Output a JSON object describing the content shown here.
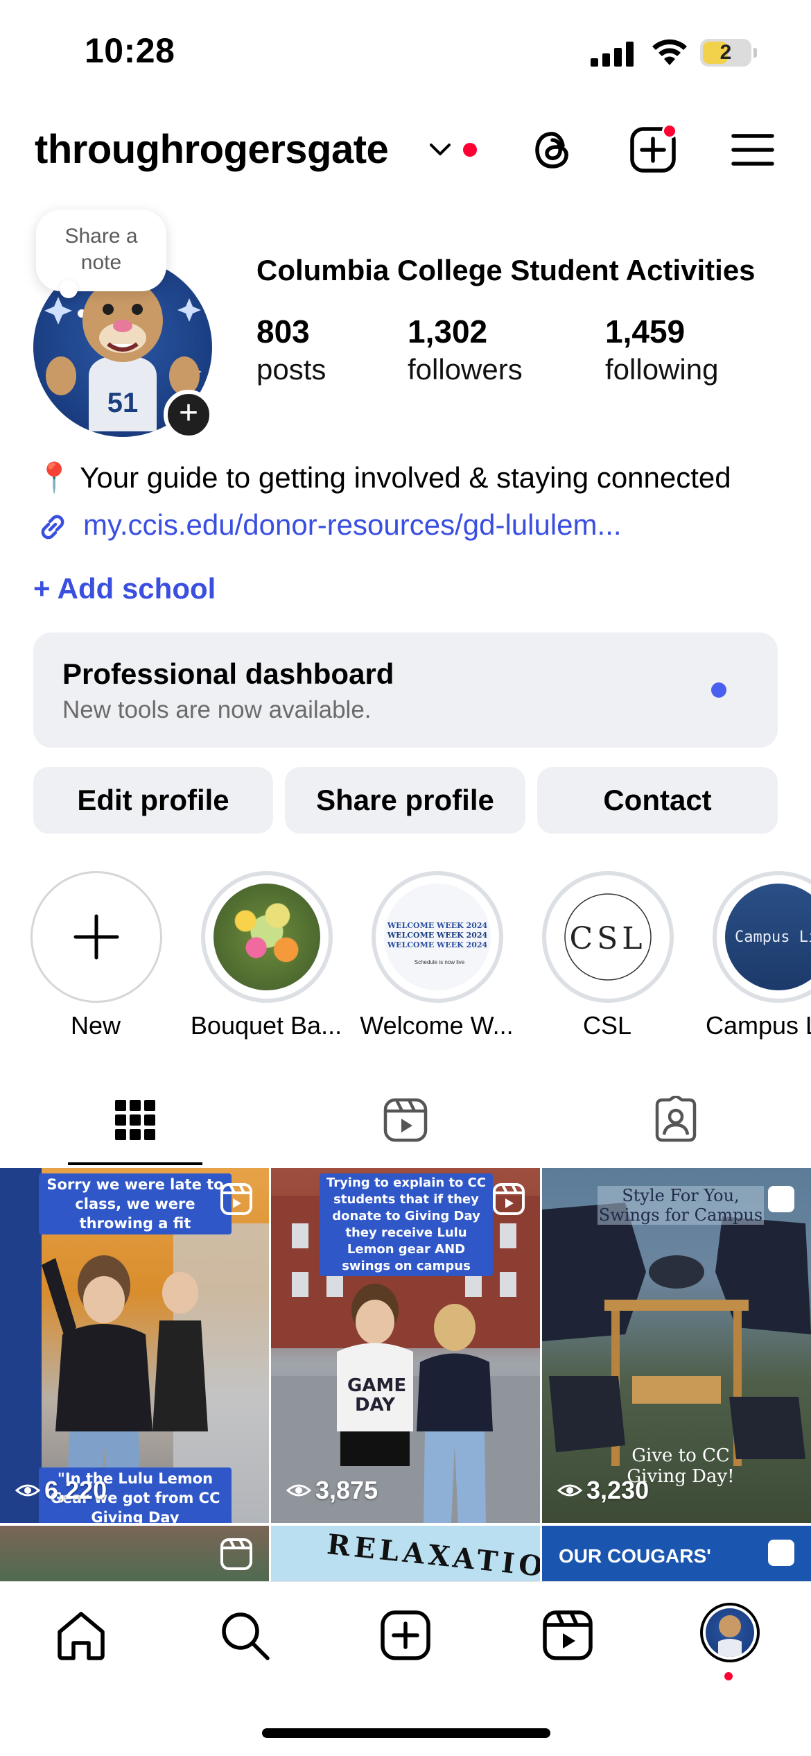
{
  "status_bar": {
    "time": "10:28",
    "battery": "2"
  },
  "header": {
    "username": "throughrogersgate"
  },
  "note": {
    "text": "Share a\nnote"
  },
  "profile": {
    "display_name": "Columbia College Student Activities",
    "stats": [
      {
        "value": "803",
        "label": "posts"
      },
      {
        "value": "1,302",
        "label": "followers"
      },
      {
        "value": "1,459",
        "label": "following"
      }
    ],
    "bio": "📍 Your guide to getting involved & staying connected",
    "link": "my.ccis.edu/donor-resources/gd-lululem...",
    "add_school": "+ Add school"
  },
  "dashboard": {
    "title": "Professional dashboard",
    "subtitle": "New tools are now available."
  },
  "buttons": {
    "edit": "Edit profile",
    "share": "Share profile",
    "contact": "Contact"
  },
  "highlights": [
    {
      "label": "New"
    },
    {
      "label": "Bouquet Ba..."
    },
    {
      "label": "Welcome W..."
    },
    {
      "label": "CSL"
    },
    {
      "label": "Campus L"
    }
  ],
  "highlight_art": {
    "welcome_lines": [
      "WELCOME WEEK 2024",
      "WELCOME WEEK 2024",
      "WELCOME WEEK 2024"
    ],
    "welcome_foot": "Schedule is now live",
    "csl": "CSL",
    "campus": "Campus Li"
  },
  "posts": [
    {
      "caption_top": "Sorry we were late to class, we were throwing a fit",
      "caption_bottom": "\"In the Lulu Lemon Gear we got from CC Giving Day",
      "views": "6,220"
    },
    {
      "caption_top": "Trying to explain to CC students that if they donate to Giving Day they receive Lulu Lemon gear AND swings on campus",
      "shirt": "GAME DAY",
      "views": "3,875"
    },
    {
      "title": "Style For You, Swings for Campus",
      "footer": "Give to CC Giving Day!",
      "views": "3,230"
    },
    {
      "text": ""
    },
    {
      "text": "RELAXATION"
    },
    {
      "text": "OUR COUGARS'"
    }
  ],
  "colors": {
    "accent": "#3a4fe0",
    "notification": "#ff0033",
    "surface": "#eff0f4"
  }
}
